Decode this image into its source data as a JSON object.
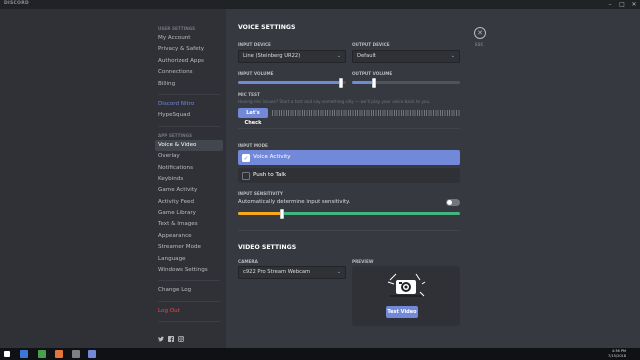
{
  "window": {
    "title": "DISCORD",
    "controls": [
      "minimize-icon",
      "maximize-icon",
      "close-icon"
    ]
  },
  "sidebar": {
    "user_settings_header": "USER SETTINGS",
    "user_items": [
      {
        "label": "My Account"
      },
      {
        "label": "Privacy & Safety"
      },
      {
        "label": "Authorized Apps"
      },
      {
        "label": "Connections"
      },
      {
        "label": "Billing"
      }
    ],
    "nitro_label": "Discord Nitro",
    "hypesquad_label": "HypeSquad",
    "app_settings_header": "APP SETTINGS",
    "app_items": [
      {
        "label": "Voice & Video",
        "active": true
      },
      {
        "label": "Overlay"
      },
      {
        "label": "Notifications"
      },
      {
        "label": "Keybinds"
      },
      {
        "label": "Game Activity"
      },
      {
        "label": "Activity Feed"
      },
      {
        "label": "Game Library"
      },
      {
        "label": "Text & Images"
      },
      {
        "label": "Appearance"
      },
      {
        "label": "Streamer Mode"
      },
      {
        "label": "Language"
      },
      {
        "label": "Windows Settings"
      }
    ],
    "change_log_label": "Change Log",
    "log_out_label": "Log Out",
    "socials": [
      "twitter-icon",
      "facebook-icon",
      "instagram-icon"
    ]
  },
  "voice": {
    "title": "VOICE SETTINGS",
    "input_device_label": "INPUT DEVICE",
    "input_device_value": "Line (Steinberg UR22)",
    "output_device_label": "OUTPUT DEVICE",
    "output_device_value": "Default",
    "input_volume_label": "INPUT VOLUME",
    "input_volume_level": 0.95,
    "output_volume_label": "OUTPUT VOLUME",
    "output_volume_level": 0.2,
    "mic_test_label": "MIC TEST",
    "mic_test_desc": "Having mic issues? Start a test and say something silly — we'll play your voice back to you.",
    "lets_check_label": "Let's Check",
    "input_mode_label": "INPUT MODE",
    "voice_activity_label": "Voice Activity",
    "push_to_talk_label": "Push to Talk",
    "input_sensitivity_label": "INPUT SENSITIVITY",
    "auto_sensitivity_label": "Automatically determine input sensitivity.",
    "auto_sensitivity_enabled": false,
    "sensitivity_level": 0.2
  },
  "video": {
    "title": "VIDEO SETTINGS",
    "camera_label": "CAMERA",
    "camera_value": "c922 Pro Stream Webcam",
    "preview_label": "PREVIEW",
    "test_video_label": "Test Video"
  },
  "close": {
    "esc_label": "ESC"
  },
  "colors": {
    "accent": "#7289da",
    "active_meter": "#43b581",
    "meter_low": "#faa61a",
    "danger": "#f04747"
  },
  "taskbar": {
    "time": "4:36 PM",
    "date": "7/15/2018"
  }
}
